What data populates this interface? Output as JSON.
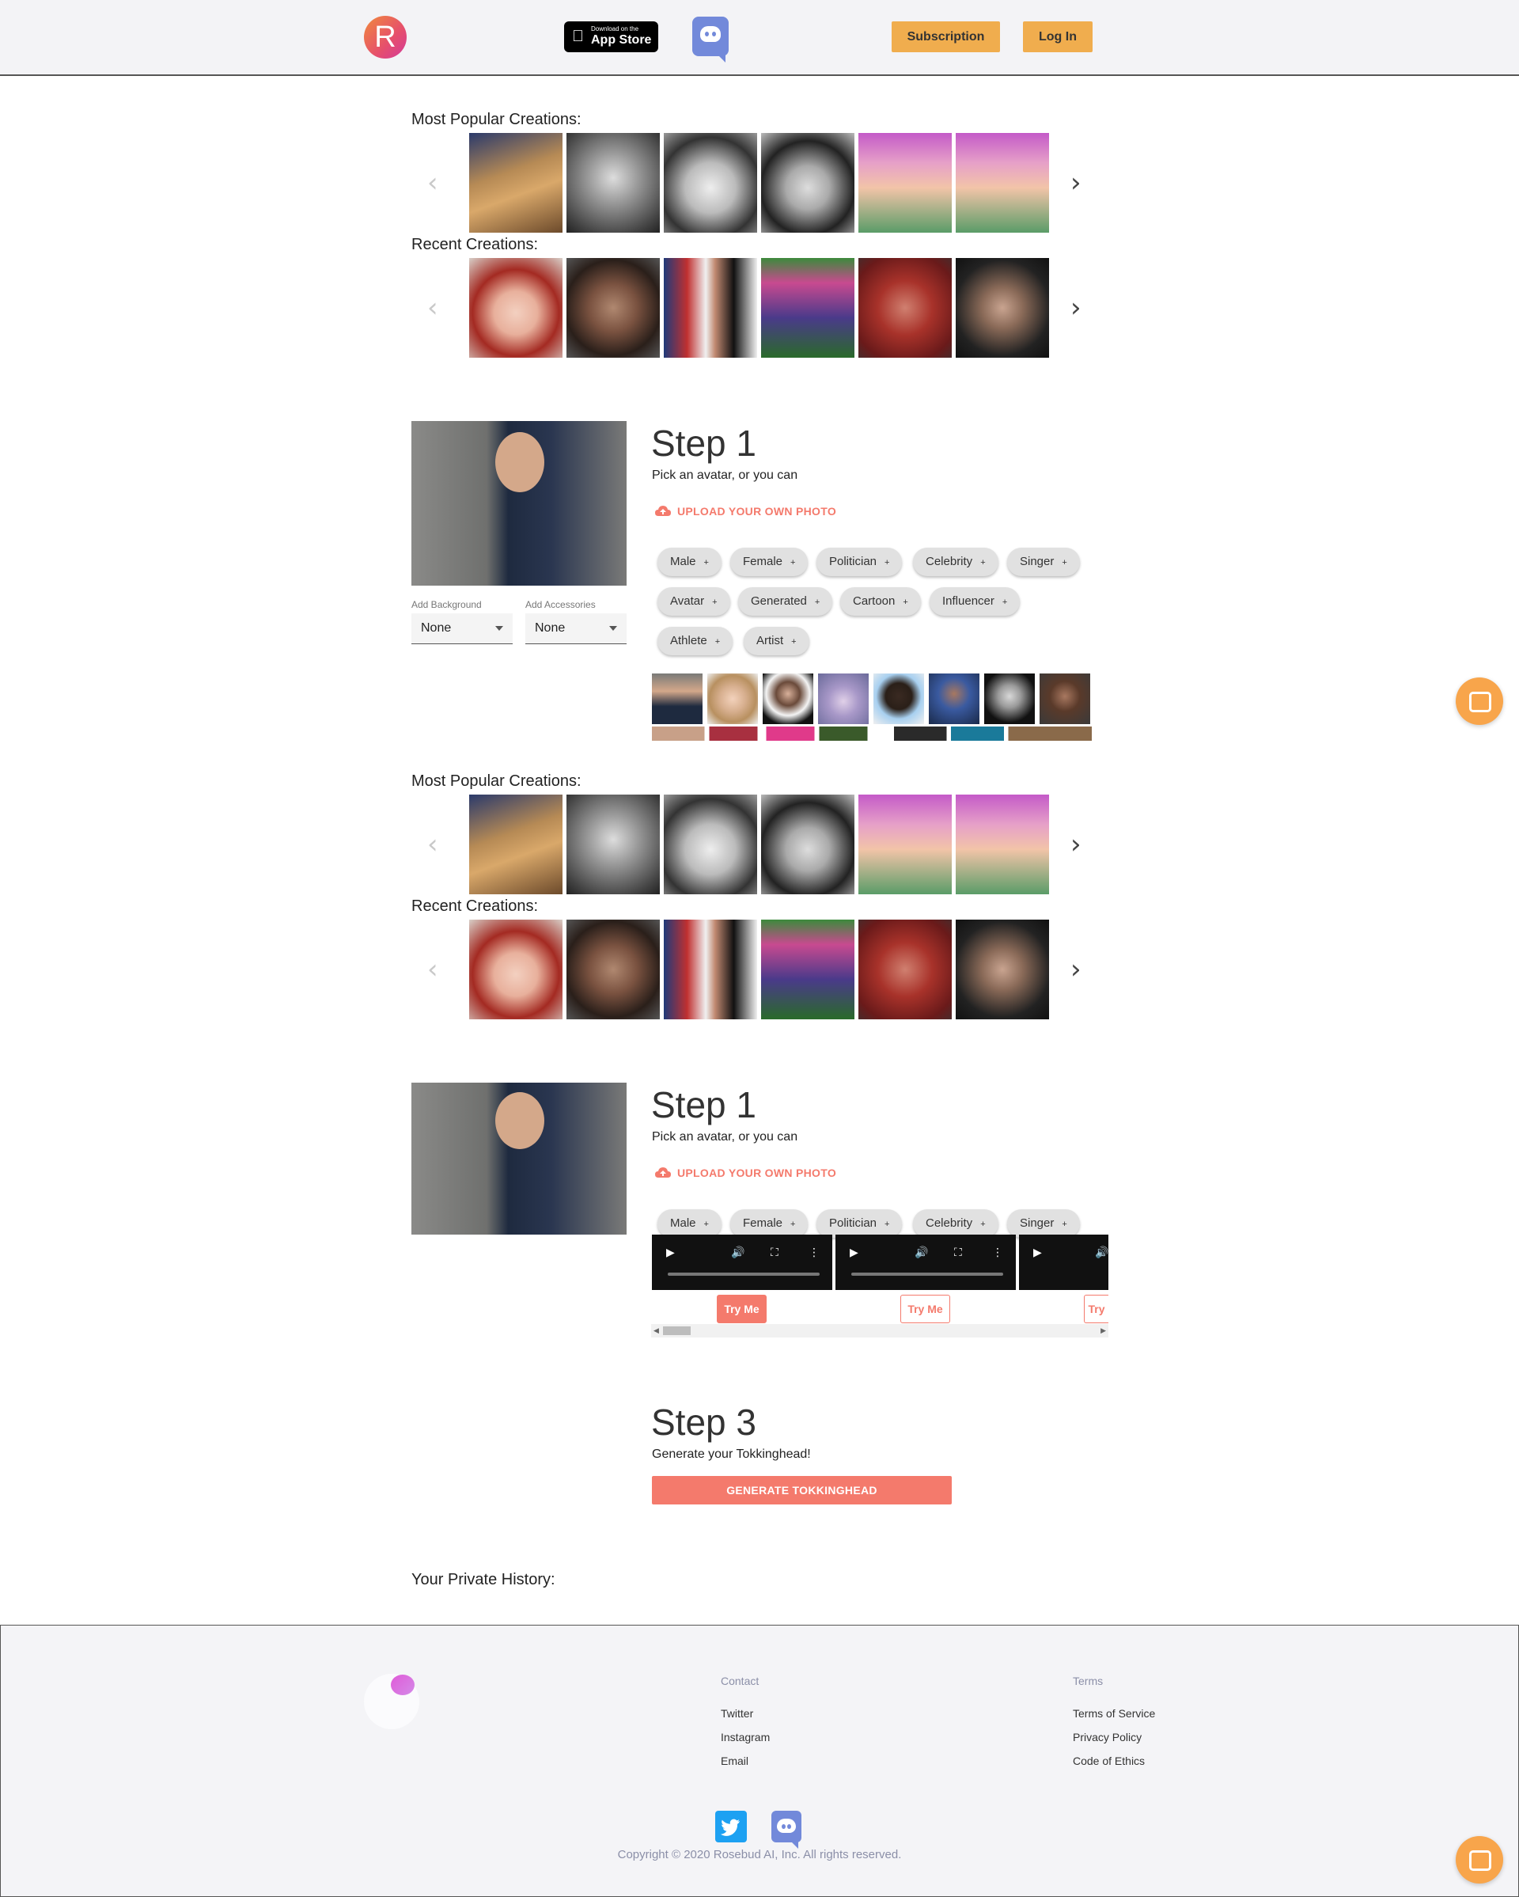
{
  "header": {
    "appstore_small": "Download on the",
    "appstore_big": "App Store",
    "subscription": "Subscription",
    "login": "Log In",
    "logo_letter": "R"
  },
  "gallery1": {
    "popular_title": "Most Popular Creations:",
    "recent_title": "Recent Creations:"
  },
  "gallery2": {
    "popular_title": "Most Popular Creations:",
    "recent_title": "Recent Creations:"
  },
  "popular_images": [
    "popular-1",
    "popular-2",
    "popular-3",
    "popular-4",
    "popular-5",
    "popular-6"
  ],
  "recent_images": [
    "recent-1",
    "recent-2",
    "recent-3",
    "recent-4",
    "recent-5",
    "recent-6"
  ],
  "step1": {
    "title": "Step 1",
    "subtitle": "Pick an avatar, or you can",
    "upload": "UPLOAD YOUR OWN PHOTO",
    "background_label": "Add Background",
    "background_value": "None",
    "accessories_label": "Add Accessories",
    "accessories_value": "None",
    "chips": [
      "Male",
      "Female",
      "Politician",
      "Celebrity",
      "Singer",
      "Avatar",
      "Generated",
      "Cartoon",
      "Influencer",
      "Athlete",
      "Artist"
    ]
  },
  "step1b": {
    "title": "Step 1",
    "subtitle": "Pick an avatar, or you can",
    "upload": "UPLOAD YOUR OWN PHOTO",
    "chips": [
      "Male",
      "Female",
      "Politician",
      "Celebrity",
      "Singer"
    ],
    "try_me": "Try Me",
    "try_partial": "Try"
  },
  "step3": {
    "title": "Step 3",
    "subtitle": "Generate your Tokkinghead!",
    "button": "GENERATE TOKKINGHEAD"
  },
  "history": {
    "title": "Your Private History:"
  },
  "footer": {
    "contact_heading": "Contact",
    "contact_links": [
      "Twitter",
      "Instagram",
      "Email"
    ],
    "terms_heading": "Terms",
    "terms_links": [
      "Terms of Service",
      "Privacy Policy",
      "Code of Ethics"
    ],
    "copyright": "Copyright © 2020 Rosebud AI, Inc. All rights reserved."
  },
  "colors": {
    "accent_orange": "#f0ad4e",
    "accent_coral": "#f47a6c",
    "discord": "#7289da",
    "twitter": "#1da1f2"
  }
}
